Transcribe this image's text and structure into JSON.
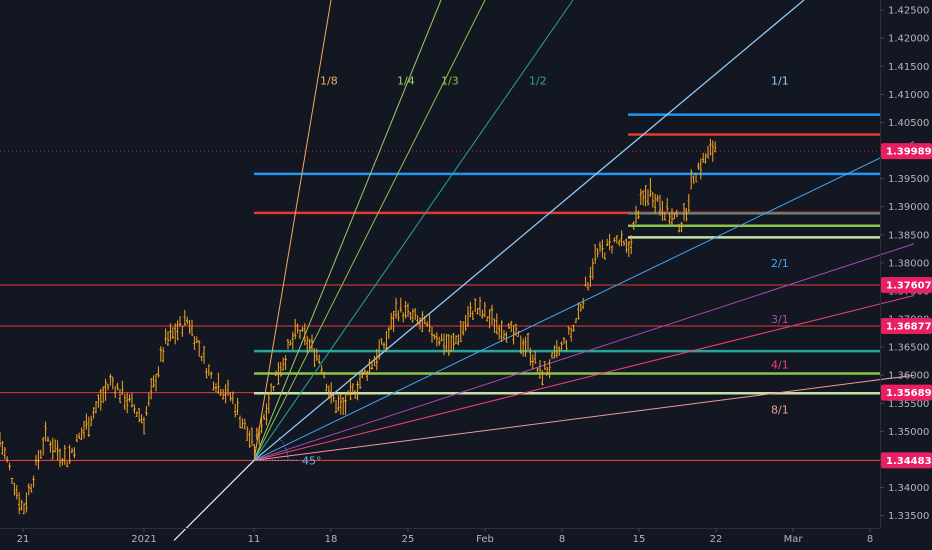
{
  "chart_data": {
    "type": "bar",
    "title": "",
    "ylim": [
      1.3328,
      1.4268
    ],
    "colors": {
      "background": "#131722",
      "price_bar": "#f5a623",
      "red_level": "#e53935",
      "blue_level": "#2196f3",
      "teal_level": "#26a69a",
      "green_level": "#8bc34a",
      "light_green_level": "#c5e1a5",
      "price_tag": "#e91e63",
      "price_tag_current": "#e91e63",
      "axis_text": "#b2b5be"
    },
    "y_ticks": [
      "1.42500",
      "1.42000",
      "1.41500",
      "1.41000",
      "1.40500",
      "1.40000",
      "1.39500",
      "1.39000",
      "1.38500",
      "1.38000",
      "1.37500",
      "1.37000",
      "1.36500",
      "1.36000",
      "1.35500",
      "1.35000",
      "1.34500",
      "1.34000",
      "1.33500"
    ],
    "x_ticks": [
      "21",
      "2021",
      "11",
      "18",
      "25",
      "Feb",
      "8",
      "15",
      "22",
      "Mar",
      "8"
    ],
    "current_price": "1.39989",
    "price_tags": [
      "1.37607",
      "1.36877",
      "1.35689",
      "1.34483"
    ],
    "horizontal_levels": [
      {
        "price": 1.37607,
        "color": "red_level",
        "full": true,
        "width": 1
      },
      {
        "price": 1.36877,
        "color": "red_level",
        "full": true,
        "width": 1
      },
      {
        "price": 1.35689,
        "color": "red_level",
        "full": true,
        "width": 1
      },
      {
        "price": 1.34483,
        "color": "red_level",
        "full": true,
        "width": 1.2
      },
      {
        "price": 1.4064,
        "color": "blue_level",
        "full": false,
        "start": "2021-02-14",
        "width": 2.5
      },
      {
        "price": 1.40285,
        "color": "red_level",
        "full": false,
        "start": "2021-02-14",
        "width": 2.5
      },
      {
        "price": 1.39585,
        "color": "blue_level",
        "full": false,
        "start": "2021-01-11",
        "width": 2.5
      },
      {
        "price": 1.3889,
        "color": "red_level",
        "full": false,
        "start": "2021-01-11",
        "width": 2.5
      },
      {
        "price": 1.38875,
        "color": "teal_level",
        "full": false,
        "start": "2021-02-14",
        "width": 1.5
      },
      {
        "price": 1.3866,
        "color": "green_level",
        "full": false,
        "start": "2021-02-14",
        "width": 2.5
      },
      {
        "price": 1.38455,
        "color": "light_green_level",
        "full": false,
        "start": "2021-02-14",
        "width": 2.5
      },
      {
        "price": 1.3643,
        "color": "teal_level",
        "full": false,
        "start": "2021-01-11",
        "width": 2.5
      },
      {
        "price": 1.3603,
        "color": "green_level",
        "full": false,
        "start": "2021-01-11",
        "width": 2.5
      },
      {
        "price": 1.3568,
        "color": "light_green_level",
        "full": false,
        "start": "2021-01-11",
        "width": 2.5
      }
    ],
    "gann_fan": {
      "origin": {
        "date": "2021-01-11",
        "price": 1.34483
      },
      "lines": [
        {
          "label": "1/8",
          "color": "#f5a95c",
          "end_date": "2021-01-18",
          "end_price": 1.4268,
          "label_date": "2021-01-17",
          "label_price": 1.4118
        },
        {
          "label": "1/4",
          "color": "#9ccc65",
          "end_date": "2021-01-28",
          "end_price": 1.4268,
          "label_date": "2021-01-24",
          "label_price": 1.4118
        },
        {
          "label": "1/3",
          "color": "#8bc34a",
          "end_date": "2021-02-01",
          "end_price": 1.4268,
          "label_date": "2021-01-28",
          "label_price": 1.4118
        },
        {
          "label": "1/2",
          "color": "#26a69a",
          "end_date": "2021-02-09",
          "end_price": 1.4268,
          "label_date": "2021-02-05",
          "label_price": 1.4118
        },
        {
          "label": "1/1",
          "color": "#90caf9",
          "end_date": "2021-03-02",
          "end_price": 1.4268,
          "label_date": "2021-02-27",
          "label_price": 1.4118
        },
        {
          "label": "2/1",
          "color": "#42a5f5",
          "end_date": "2021-03-12",
          "end_price": 1.4016,
          "label_date": "2021-02-27",
          "label_price": 1.3793
        },
        {
          "label": "3/1",
          "color": "#ab47bc",
          "end_date": "2021-03-12",
          "end_price": 1.3834,
          "label_date": "2021-02-27",
          "label_price": 1.3693
        },
        {
          "label": "4/1",
          "color": "#ec407a",
          "end_date": "2021-03-12",
          "end_price": 1.3742,
          "label_date": "2021-02-27",
          "label_price": 1.3612
        },
        {
          "label": "8/1",
          "color": "#ef9a9a",
          "end_date": "2021-03-12",
          "end_price": 1.36,
          "label_date": "2021-02-27",
          "label_price": 1.3532
        }
      ],
      "angle_label": "45°",
      "angle_color": "#64b5f6"
    },
    "price_path": [
      {
        "date": "2020-12-14",
        "price": 1.35
      },
      {
        "date": "2020-12-16",
        "price": 1.36
      },
      {
        "date": "2020-12-18",
        "price": 1.354
      },
      {
        "date": "2020-12-21",
        "price": 1.336
      },
      {
        "date": "2020-12-23",
        "price": 1.349
      },
      {
        "date": "2020-12-25",
        "price": 1.345
      },
      {
        "date": "2020-12-29",
        "price": 1.359
      },
      {
        "date": "2021-01-01",
        "price": 1.352
      },
      {
        "date": "2021-01-03",
        "price": 1.366
      },
      {
        "date": "2021-01-05",
        "price": 1.37
      },
      {
        "date": "2021-01-07",
        "price": 1.36
      },
      {
        "date": "2021-01-09",
        "price": 1.356
      },
      {
        "date": "2021-01-11",
        "price": 1.347
      },
      {
        "date": "2021-01-13",
        "price": 1.36
      },
      {
        "date": "2021-01-15",
        "price": 1.368
      },
      {
        "date": "2021-01-17",
        "price": 1.363
      },
      {
        "date": "2021-01-18",
        "price": 1.356
      },
      {
        "date": "2021-01-19",
        "price": 1.354
      },
      {
        "date": "2021-01-21",
        "price": 1.36
      },
      {
        "date": "2021-01-23",
        "price": 1.366
      },
      {
        "date": "2021-01-24",
        "price": 1.372
      },
      {
        "date": "2021-01-27",
        "price": 1.368
      },
      {
        "date": "2021-01-29",
        "price": 1.365
      },
      {
        "date": "2021-01-31",
        "price": 1.372
      },
      {
        "date": "2021-02-03",
        "price": 1.368
      },
      {
        "date": "2021-02-05",
        "price": 1.365
      },
      {
        "date": "2021-02-06",
        "price": 1.36
      },
      {
        "date": "2021-02-07",
        "price": 1.362
      },
      {
        "date": "2021-02-09",
        "price": 1.368
      },
      {
        "date": "2021-02-11",
        "price": 1.381
      },
      {
        "date": "2021-02-13",
        "price": 1.384
      },
      {
        "date": "2021-02-14",
        "price": 1.382
      },
      {
        "date": "2021-02-15",
        "price": 1.39
      },
      {
        "date": "2021-02-16",
        "price": 1.393
      },
      {
        "date": "2021-02-18",
        "price": 1.388
      },
      {
        "date": "2021-02-19",
        "price": 1.387
      },
      {
        "date": "2021-02-20",
        "price": 1.396
      },
      {
        "date": "2021-02-22",
        "price": 1.401
      }
    ]
  }
}
